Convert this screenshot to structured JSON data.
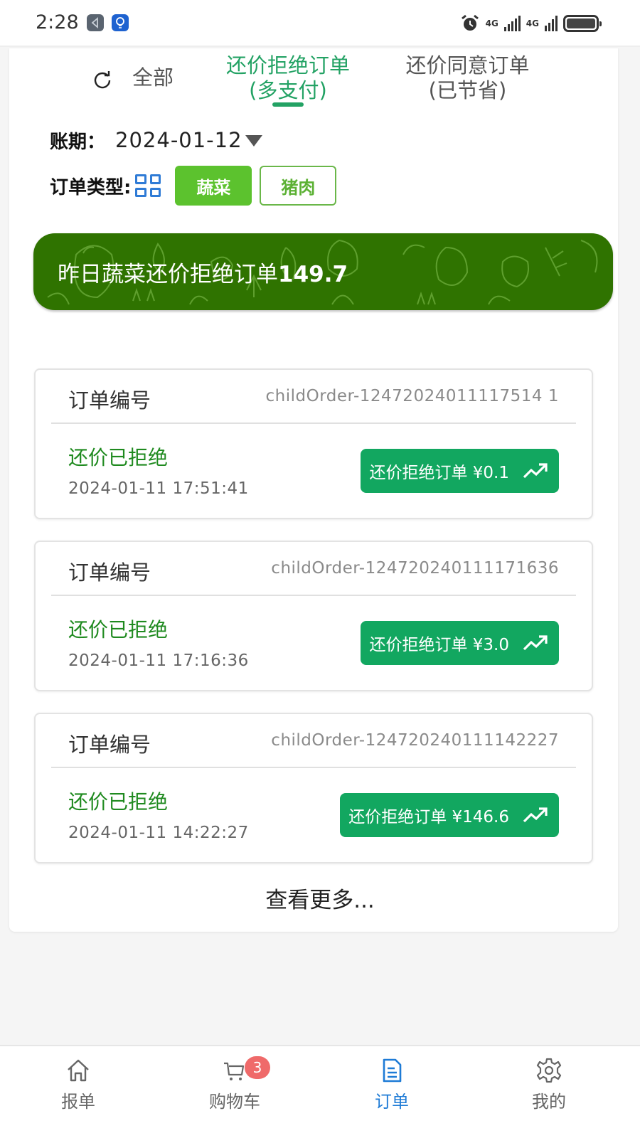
{
  "status_bar": {
    "time": "2:28",
    "network_1": "4G",
    "network_2": "4G",
    "icons": [
      "app-back-icon",
      "lightbulb-icon",
      "alarm-icon",
      "signal-icon",
      "signal-icon",
      "battery-icon"
    ]
  },
  "tabs": [
    {
      "label": "全部",
      "active": false
    },
    {
      "label_line1": "还价拒绝订单",
      "label_line2": "(多支付)",
      "active": true
    },
    {
      "label_line1": "还价同意订单",
      "label_line2": "(已节省)",
      "active": false
    }
  ],
  "filters": {
    "period_label": "账期：",
    "period_value": "2024-01-12",
    "type_label": "订单类型:",
    "types": [
      {
        "label": "蔬菜",
        "active": true
      },
      {
        "label": "猪肉",
        "active": false
      }
    ]
  },
  "banner": {
    "text": "昨日蔬菜还价拒绝订单",
    "value": "149.7"
  },
  "orders": [
    {
      "label": "订单编号",
      "number": "childOrder-12472024011117514 1",
      "status": "还价已拒绝",
      "time": "2024-01-11 17:51:41",
      "amount_label": "还价拒绝订单 ¥0.1"
    },
    {
      "label": "订单编号",
      "number": "childOrder-124720240111171636",
      "status": "还价已拒绝",
      "time": "2024-01-11 17:16:36",
      "amount_label": "还价拒绝订单 ¥3.0"
    },
    {
      "label": "订单编号",
      "number": "childOrder-124720240111142227",
      "status": "还价已拒绝",
      "time": "2024-01-11 14:22:27",
      "amount_label": "还价拒绝订单 ¥146.6"
    }
  ],
  "more_label": "查看更多...",
  "bottom_nav": [
    {
      "label": "报单",
      "icon": "home-icon",
      "active": false
    },
    {
      "label": "购物车",
      "icon": "cart-icon",
      "active": false,
      "badge": "3"
    },
    {
      "label": "订单",
      "icon": "document-icon",
      "active": true
    },
    {
      "label": "我的",
      "icon": "gear-icon",
      "active": false
    }
  ],
  "colors": {
    "accent_green": "#23a264",
    "banner_green": "#2f7300",
    "button_green": "#12a760",
    "type_active": "#5cc22e",
    "nav_active": "#1e7bd6",
    "badge_red": "#ef6a6a"
  }
}
